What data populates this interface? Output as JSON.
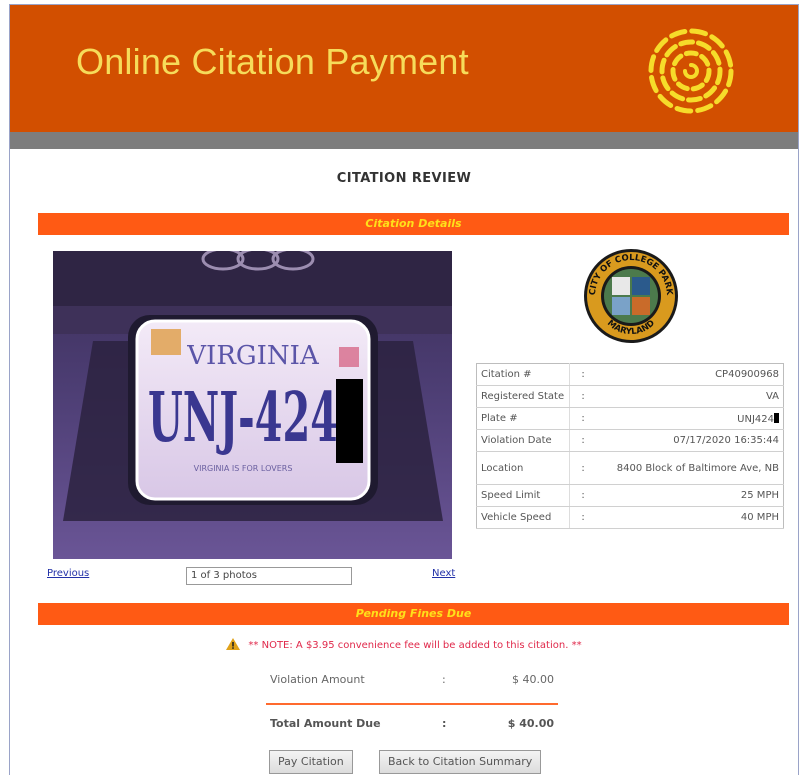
{
  "header": {
    "title": "Online Citation Payment",
    "color": "#d24f00",
    "title_color": "#f6dc5a"
  },
  "page_title": "CITATION REVIEW",
  "sections": {
    "citation_details": "Citation Details",
    "pending_fines": "Pending Fines Due"
  },
  "photo": {
    "plate_state": "VIRGINIA",
    "plate_text": "UNJ-424",
    "plate_tagline": "VIRGINIA IS FOR LOVERS",
    "counter": "1 of 3 photos",
    "previous_label": "Previous",
    "next_label": "Next"
  },
  "seal": {
    "top_text": "CITY OF COLLEGE PARK",
    "bottom_text": "MARYLAND"
  },
  "details": [
    {
      "label": "Citation #",
      "sep": ":",
      "value": "CP40900968"
    },
    {
      "label": "Registered State",
      "sep": ":",
      "value": "VA"
    },
    {
      "label": "Plate #",
      "sep": ":",
      "value": "UNJ424"
    },
    {
      "label": "Violation Date",
      "sep": ":",
      "value": "07/17/2020 16:35:44"
    },
    {
      "label": "Location",
      "sep": ":",
      "value": "8400 Block of Baltimore Ave, NB"
    },
    {
      "label": "Speed Limit",
      "sep": ":",
      "value": "25 MPH"
    },
    {
      "label": "Vehicle Speed",
      "sep": ":",
      "value": "40 MPH"
    }
  ],
  "note": "** NOTE: A $3.95 convenience fee will be added to this citation. **",
  "fees": {
    "violation_label": "Violation Amount",
    "violation_sep": ":",
    "violation_value": "$ 40.00",
    "total_label": "Total Amount Due",
    "total_sep": ":",
    "total_value": "$ 40.00"
  },
  "buttons": {
    "pay": "Pay Citation",
    "back": "Back to Citation Summary"
  },
  "icons": [
    "swirl-logo-icon",
    "city-seal-icon",
    "warning-icon"
  ],
  "accent_color": "#ff5a14"
}
